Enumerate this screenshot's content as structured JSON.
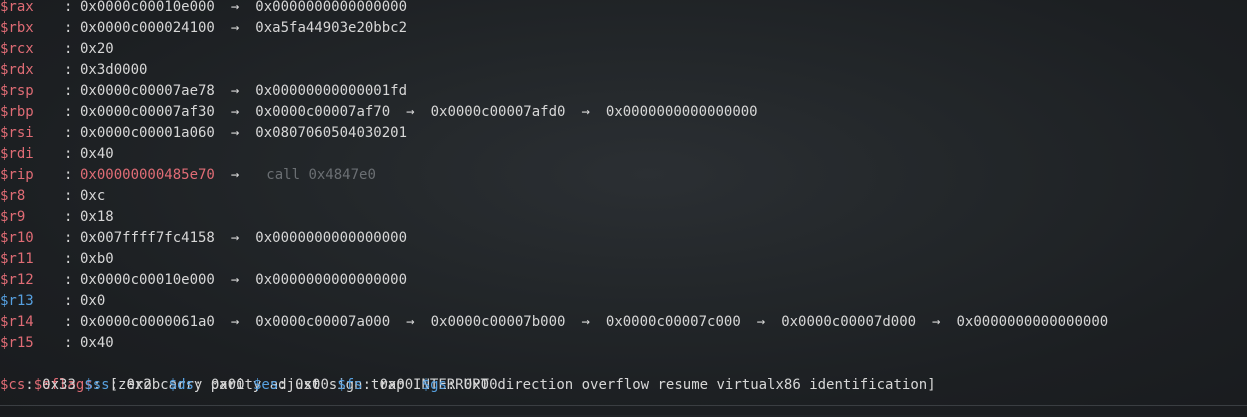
{
  "registers": [
    {
      "name": "$rax",
      "changed": false,
      "chain": [
        "0x0000c00010e000",
        "0x0000000000000000"
      ]
    },
    {
      "name": "$rbx",
      "changed": false,
      "chain": [
        "0x0000c000024100",
        "0xa5fa44903e20bbc2"
      ]
    },
    {
      "name": "$rcx",
      "changed": false,
      "chain": [
        "0x20"
      ]
    },
    {
      "name": "$rdx",
      "changed": false,
      "chain": [
        "0x3d0000"
      ]
    },
    {
      "name": "$rsp",
      "changed": false,
      "chain": [
        "0x0000c00007ae78",
        "0x00000000000001fd"
      ]
    },
    {
      "name": "$rbp",
      "changed": false,
      "chain": [
        "0x0000c00007af30",
        "0x0000c00007af70",
        "0x0000c00007afd0",
        "0x0000000000000000"
      ]
    },
    {
      "name": "$rsi",
      "changed": false,
      "chain": [
        "0x0000c00001a060",
        "0x0807060504030201"
      ]
    },
    {
      "name": "$rdi",
      "changed": false,
      "chain": [
        "0x40"
      ]
    },
    {
      "name": "$rip",
      "changed": false,
      "chain": [
        "0x00000000485e70"
      ],
      "asm": "call 0x4847e0"
    },
    {
      "name": "$r8",
      "changed": false,
      "chain": [
        "0xc"
      ]
    },
    {
      "name": "$r9",
      "changed": false,
      "chain": [
        "0x18"
      ]
    },
    {
      "name": "$r10",
      "changed": false,
      "chain": [
        "0x007ffff7fc4158",
        "0x0000000000000000"
      ]
    },
    {
      "name": "$r11",
      "changed": false,
      "chain": [
        "0xb0"
      ]
    },
    {
      "name": "$r12",
      "changed": false,
      "chain": [
        "0x0000c00010e000",
        "0x0000000000000000"
      ]
    },
    {
      "name": "$r13",
      "changed": true,
      "chain": [
        "0x0"
      ]
    },
    {
      "name": "$r14",
      "changed": false,
      "chain": [
        "0x0000c0000061a0",
        "0x0000c00007a000",
        "0x0000c00007b000",
        "0x0000c00007c000",
        "0x0000c00007d000",
        "0x0000000000000000"
      ]
    },
    {
      "name": "$r15",
      "changed": false,
      "chain": [
        "0x40"
      ]
    }
  ],
  "arrow_glyph": "→",
  "colon": ":",
  "eflags": {
    "label": "$eflags",
    "value": "[zero carry parity adjust sign trap INTERRUPT direction overflow resume virtualx86 identification]"
  },
  "segments": [
    {
      "name": "$cs",
      "value": "0x33"
    },
    {
      "name": "$ss",
      "value": "0x2b"
    },
    {
      "name": "$ds",
      "value": "0x00"
    },
    {
      "name": "$es",
      "value": "0x00"
    },
    {
      "name": "$fs",
      "value": "0x00"
    },
    {
      "name": "$gs",
      "value": "0x00"
    }
  ],
  "colors": {
    "register_name": "#e06c75",
    "register_changed": "#56a0e0",
    "value": "#d7d7d7",
    "asm_hint": "#6b6f73",
    "background": "#23272a"
  }
}
